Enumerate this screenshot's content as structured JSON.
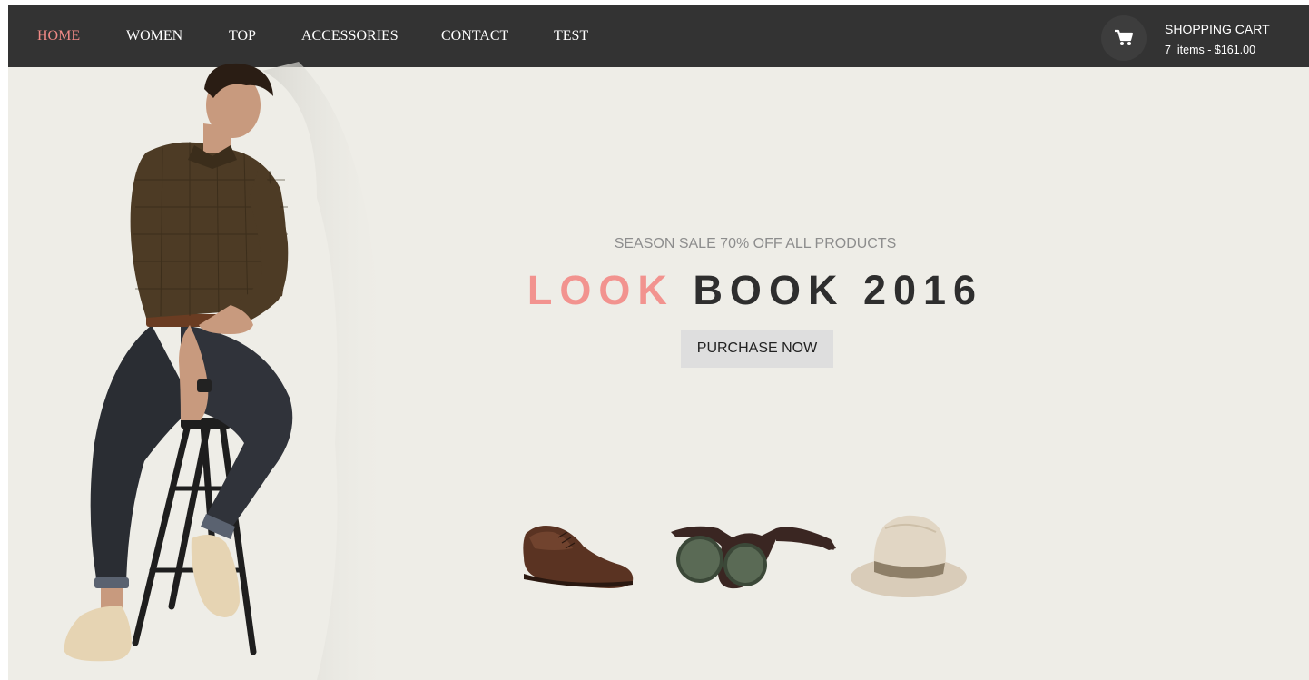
{
  "nav": {
    "items": [
      {
        "label": "HOME",
        "active": true
      },
      {
        "label": "WOMEN",
        "active": false
      },
      {
        "label": "TOP",
        "active": false
      },
      {
        "label": "ACCESSORIES",
        "active": false
      },
      {
        "label": "CONTACT",
        "active": false
      },
      {
        "label": "TEST",
        "active": false
      }
    ]
  },
  "cart": {
    "icon": "shopping-cart-icon",
    "title": "SHOPPING CART",
    "summary": "7  items - $161.00"
  },
  "hero": {
    "subtitle": "SEASON SALE 70% OFF ALL PRODUCTS",
    "title_accent": "LOOK",
    "title_main": "BOOK 2016",
    "button_label": "PURCHASE NOW"
  },
  "colors": {
    "nav_background": "#333333",
    "accent": "#f2938f",
    "page_background": "#eeede7",
    "button_background": "#dedede"
  },
  "products": [
    {
      "name": "shoe-image"
    },
    {
      "name": "sunglasses-image"
    },
    {
      "name": "hat-image"
    }
  ]
}
